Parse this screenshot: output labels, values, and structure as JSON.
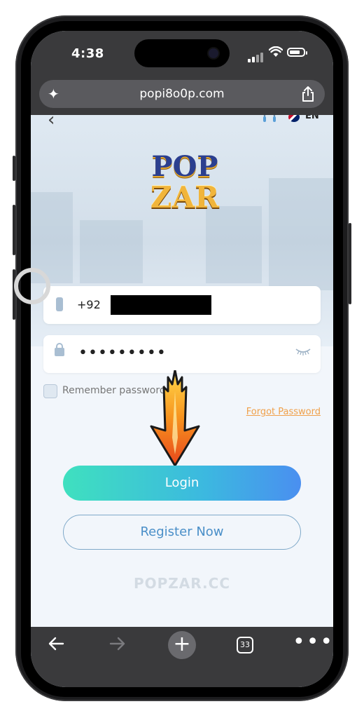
{
  "status": {
    "time": "4:38"
  },
  "browser": {
    "url": "popi8o0p.com",
    "tab_count": "33"
  },
  "header": {
    "lang": "EN"
  },
  "logo": {
    "line1": "POP",
    "line2": "ZAR"
  },
  "form": {
    "phone_prefix": "+92",
    "password_mask": "•••••••••",
    "remember_label": "Remember password",
    "forgot_label": "Forgot Password"
  },
  "buttons": {
    "login": "Login",
    "register": "Register Now"
  },
  "footer": {
    "site": "POPZAR.CC"
  },
  "colors": {
    "login_gradient_start": "#3fe0bf",
    "login_gradient_end": "#4a8ff0",
    "forgot": "#f0a04a",
    "register_text": "#4a8fc8"
  }
}
